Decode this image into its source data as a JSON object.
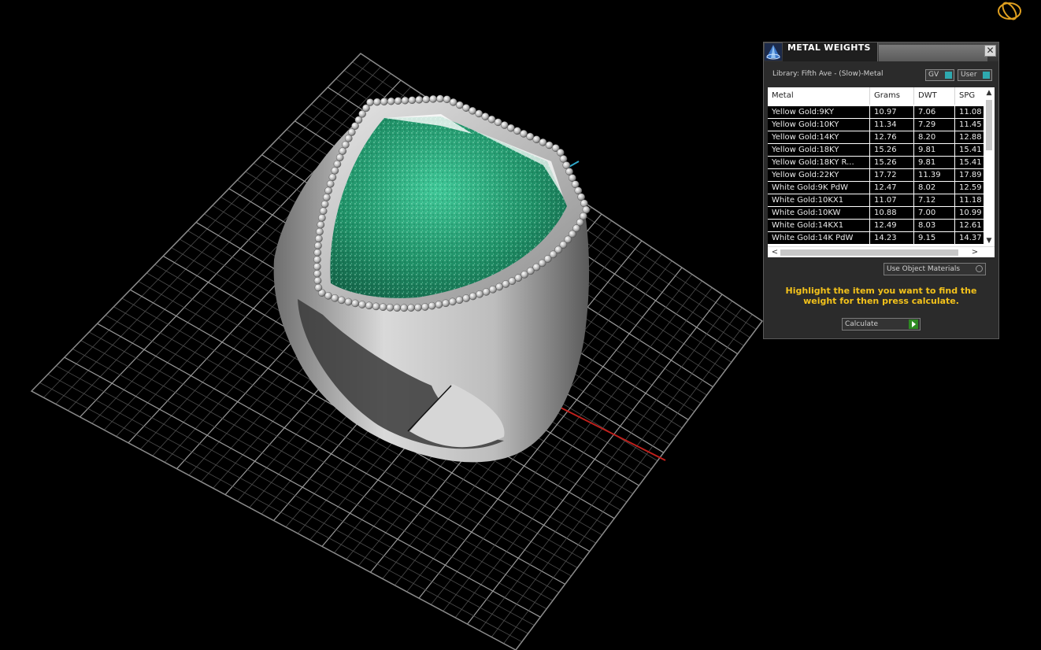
{
  "panel": {
    "title": "METAL WEIGHTS",
    "close_glyph": "✕",
    "library_label": "Library: Fifth Ave - (Slow)-Metal",
    "toggles": {
      "gv": "GV",
      "user": "User"
    },
    "table": {
      "headers": [
        "Metal",
        "Grams",
        "DWT",
        "SPG"
      ],
      "rows": [
        [
          "Yellow Gold:9KY",
          "10.97",
          "7.06",
          "11.08"
        ],
        [
          "Yellow Gold:10KY",
          "11.34",
          "7.29",
          "11.45"
        ],
        [
          "Yellow Gold:14KY",
          "12.76",
          "8.20",
          "12.88"
        ],
        [
          "Yellow Gold:18KY",
          "15.26",
          "9.81",
          "15.41"
        ],
        [
          "Yellow Gold:18KY R...",
          "15.26",
          "9.81",
          "15.41"
        ],
        [
          "Yellow Gold:22KY",
          "17.72",
          "11.39",
          "17.89"
        ],
        [
          "White Gold:9K PdW",
          "12.47",
          "8.02",
          "12.59"
        ],
        [
          "White Gold:10KX1",
          "11.07",
          "7.12",
          "11.18"
        ],
        [
          "White Gold:10KW",
          "10.88",
          "7.00",
          "10.99"
        ],
        [
          "White Gold:14KX1",
          "12.49",
          "8.03",
          "12.61"
        ],
        [
          "White Gold:14K PdW",
          "14.23",
          "9.15",
          "14.37"
        ]
      ]
    },
    "use_object_materials": "Use Object Materials",
    "hint": "Highlight the item you want to find the weight for then press calculate.",
    "calculate_label": "Calculate"
  },
  "icons": {
    "app_logo": "matrix-logo-icon",
    "orbit": "orbit-icon"
  },
  "colors": {
    "background": "#000000",
    "grid": "#8a8a8a",
    "pave": "#1f9a6e",
    "metal": "#c8c8c8",
    "hint": "#f3c21b",
    "accent": "#2eaab0",
    "axis_x": "#c0201c"
  }
}
